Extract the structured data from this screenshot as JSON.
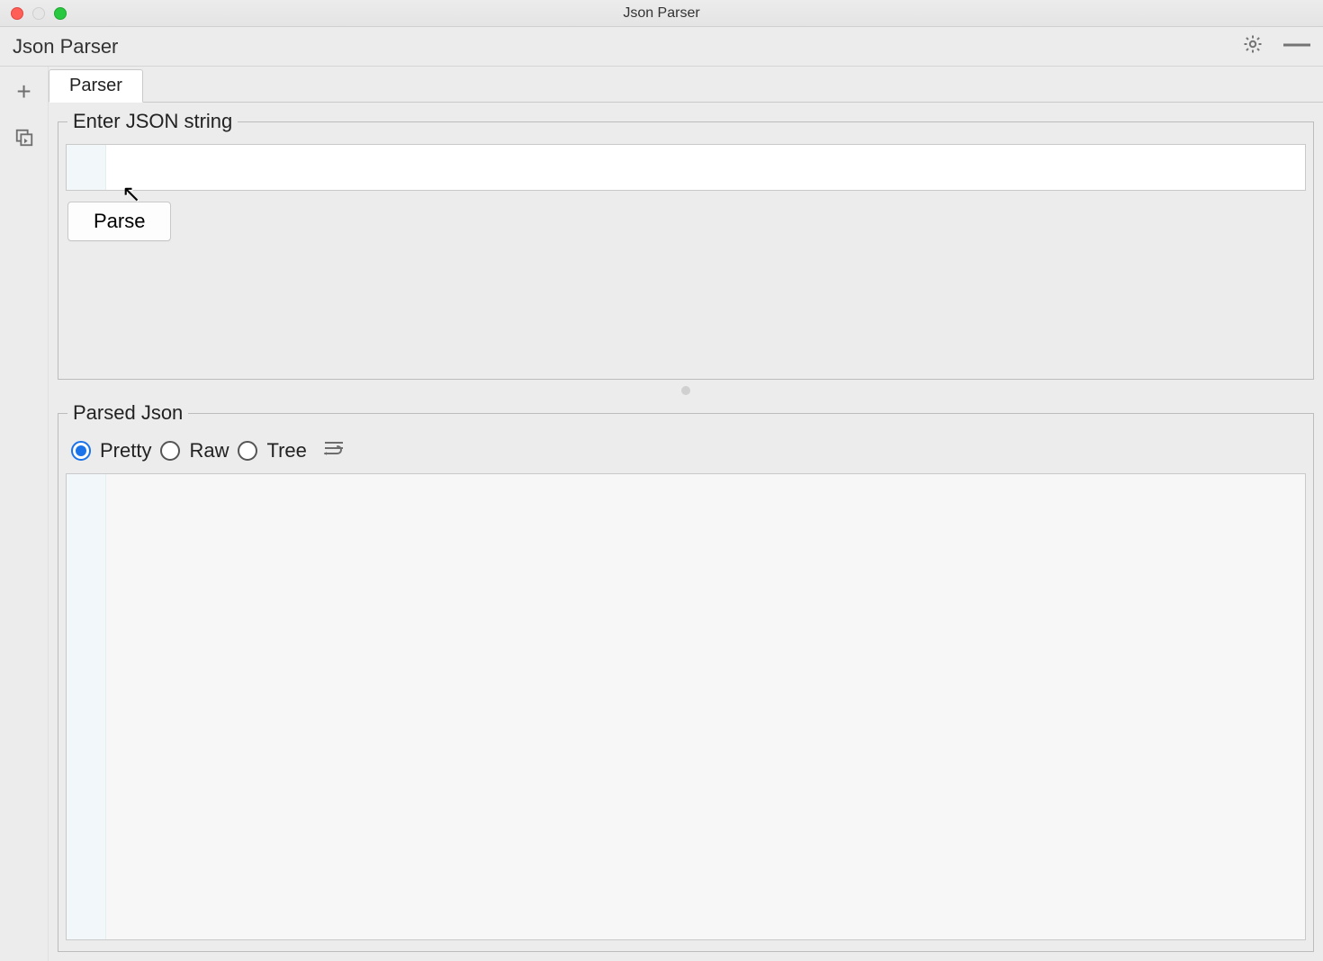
{
  "window": {
    "title": "Json Parser"
  },
  "toolbar": {
    "title": "Json Parser"
  },
  "tabs": {
    "active": "Parser"
  },
  "input_group": {
    "legend": "Enter JSON string",
    "value": "",
    "button": "Parse"
  },
  "output_group": {
    "legend": "Parsed Json",
    "view_modes": {
      "pretty": "Pretty",
      "raw": "Raw",
      "tree": "Tree",
      "selected": "pretty"
    },
    "value": ""
  }
}
